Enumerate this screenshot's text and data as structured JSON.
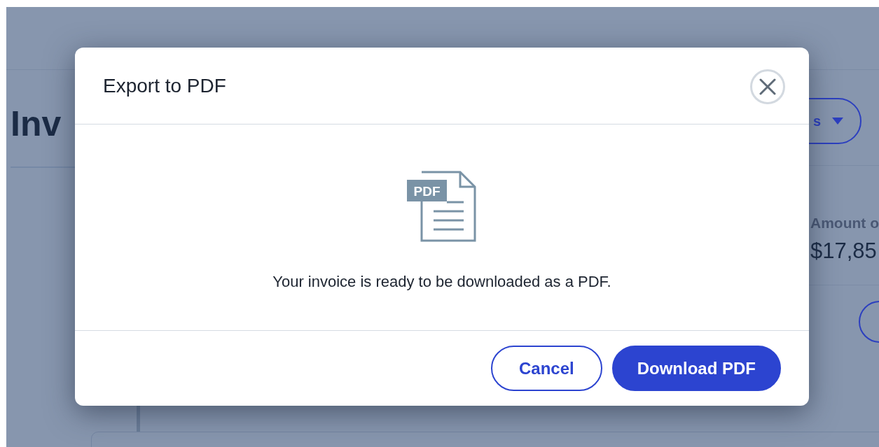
{
  "background": {
    "heading": "Inv",
    "filter_button": "s",
    "amount_label": "Amount o",
    "amount_value": "$17,85"
  },
  "dialog": {
    "title": "Export to PDF",
    "icon_label": "PDF",
    "message": "Your invoice is ready to be downloaded as a PDF.",
    "buttons": [
      {
        "label": "Cancel",
        "kind": "secondary"
      },
      {
        "label": "Download PDF",
        "kind": "primary"
      }
    ]
  }
}
